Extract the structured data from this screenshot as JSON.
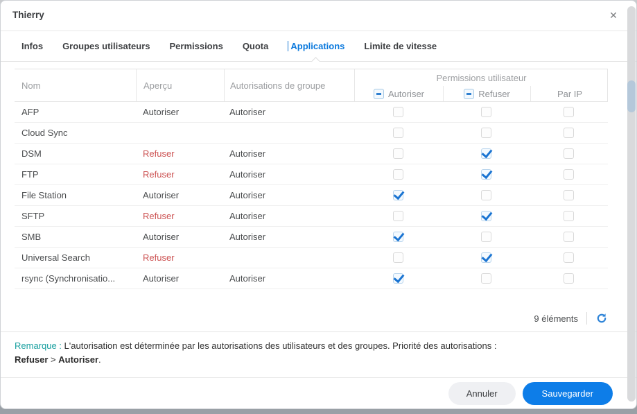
{
  "window": {
    "title": "Thierry",
    "close_glyph": "✕"
  },
  "tabs": [
    {
      "label": "Infos",
      "active": false
    },
    {
      "label": "Groupes utilisateurs",
      "active": false
    },
    {
      "label": "Permissions",
      "active": false
    },
    {
      "label": "Quota",
      "active": false
    },
    {
      "label": "Applications",
      "active": true
    },
    {
      "label": "Limite de vitesse",
      "active": false
    }
  ],
  "table": {
    "columns": {
      "name": "Nom",
      "preview": "Aperçu",
      "group": "Autorisations de groupe",
      "user_permissions": "Permissions utilisateur",
      "allow": "Autoriser",
      "deny": "Refuser",
      "by_ip": "Par IP"
    },
    "rows": [
      {
        "name": "AFP",
        "preview": "Autoriser",
        "preview_deny": false,
        "group": "Autoriser",
        "allow": false,
        "deny": false,
        "by_ip": false
      },
      {
        "name": "Cloud Sync",
        "preview": "",
        "preview_deny": false,
        "group": "",
        "allow": false,
        "deny": false,
        "by_ip": false
      },
      {
        "name": "DSM",
        "preview": "Refuser",
        "preview_deny": true,
        "group": "Autoriser",
        "allow": false,
        "deny": true,
        "by_ip": false
      },
      {
        "name": "FTP",
        "preview": "Refuser",
        "preview_deny": true,
        "group": "Autoriser",
        "allow": false,
        "deny": true,
        "by_ip": false
      },
      {
        "name": "File Station",
        "preview": "Autoriser",
        "preview_deny": false,
        "group": "Autoriser",
        "allow": true,
        "deny": false,
        "by_ip": false
      },
      {
        "name": "SFTP",
        "preview": "Refuser",
        "preview_deny": true,
        "group": "Autoriser",
        "allow": false,
        "deny": true,
        "by_ip": false
      },
      {
        "name": "SMB",
        "preview": "Autoriser",
        "preview_deny": false,
        "group": "Autoriser",
        "allow": true,
        "deny": false,
        "by_ip": false
      },
      {
        "name": "Universal Search",
        "preview": "Refuser",
        "preview_deny": true,
        "group": "",
        "allow": false,
        "deny": true,
        "by_ip": false
      },
      {
        "name": "rsync (Synchronisatio...",
        "preview": "Autoriser",
        "preview_deny": false,
        "group": "Autoriser",
        "allow": true,
        "deny": false,
        "by_ip": false
      }
    ]
  },
  "pager": {
    "count": "9 éléments"
  },
  "note": {
    "label": "Remarque :",
    "text": " L'autorisation est déterminée par les autorisations des utilisateurs et des groupes. Priorité des autorisations :",
    "priority_deny": "Refuser",
    "separator": " > ",
    "priority_allow": "Autoriser",
    "period": "."
  },
  "footer": {
    "cancel_label": "Annuler",
    "save_label": "Sauvegarder"
  },
  "colors": {
    "accent_blue": "#0d7de8",
    "active_tab_blue": "#0b79dd",
    "deny_red": "#cc5252",
    "note_teal": "#1aa0a0",
    "check_blue": "#1a74d2",
    "scrollbar_thumb": "#b5c8da"
  }
}
